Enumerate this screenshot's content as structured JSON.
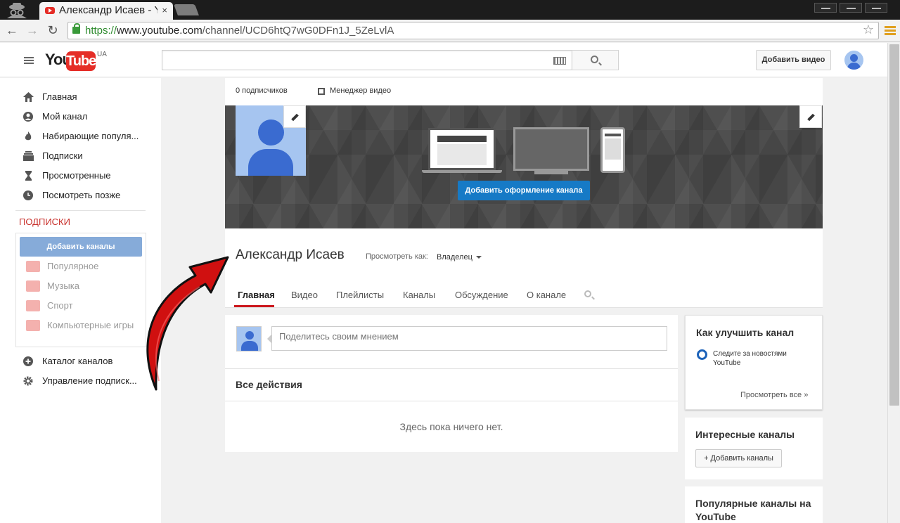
{
  "browser": {
    "tab_title": "Александр Исаев - Y",
    "tab_close": "×",
    "url_scheme": "https://",
    "url_host": "www.youtube.com",
    "url_path": "/channel/UCD6htQ7wG0DFn1J_5ZeLvlA",
    "star_glyph": "☆",
    "back_glyph": "←",
    "forward_glyph": "→",
    "reload_glyph": "↻"
  },
  "masthead": {
    "logo_you": "You",
    "logo_tube": "Tube",
    "logo_region": "UA",
    "search_placeholder": "",
    "upload_label": "Добавить видео"
  },
  "guide": {
    "items": [
      {
        "label": "Главная",
        "icon": "home-icon"
      },
      {
        "label": "Мой канал",
        "icon": "user-circle-icon"
      },
      {
        "label": "Набирающие популя...",
        "icon": "flame-icon"
      },
      {
        "label": "Подписки",
        "icon": "subscriptions-icon"
      },
      {
        "label": "Просмотренные",
        "icon": "hourglass-icon"
      },
      {
        "label": "Посмотреть позже",
        "icon": "clock-icon"
      }
    ],
    "subs_heading": "ПОДПИСКИ",
    "add_channels_label": "Добавить каналы",
    "sub_items": [
      {
        "label": "Популярное",
        "icon": "popular-icon"
      },
      {
        "label": "Музыка",
        "icon": "headphones-icon"
      },
      {
        "label": "Спорт",
        "icon": "trophy-icon"
      },
      {
        "label": "Компьютерные игры",
        "icon": "gamepad-icon"
      }
    ],
    "bottom_items": [
      {
        "label": "Каталог каналов",
        "icon": "plus-circle-icon"
      },
      {
        "label": "Управление подписк...",
        "icon": "gear-icon"
      }
    ]
  },
  "channel": {
    "subscribers": "0 подписчиков",
    "video_manager": "Менеджер видео",
    "add_art_label": "Добавить оформление канала",
    "name": "Александр Исаев",
    "view_as_label": "Просмотреть как:",
    "view_as_value": "Владелец",
    "tabs": [
      "Главная",
      "Видео",
      "Плейлисты",
      "Каналы",
      "Обсуждение",
      "О канале"
    ]
  },
  "feed": {
    "share_placeholder": "Поделитесь своим мнением",
    "activity_heading": "Все действия",
    "empty_message": "Здесь пока ничего нет."
  },
  "sidebar_right": {
    "improve_title": "Как улучшить канал",
    "improve_tip": "Следите за новостями YouTube",
    "see_all": "Просмотреть все  »",
    "interest_title": "Интересные каналы",
    "interest_add": "+ Добавить каналы",
    "popular_title": "Популярные каналы на YouTube"
  },
  "colors": {
    "youtube_red": "#e52d27",
    "accent_blue": "#167ac6",
    "annotation_arrow": "#d01010"
  }
}
